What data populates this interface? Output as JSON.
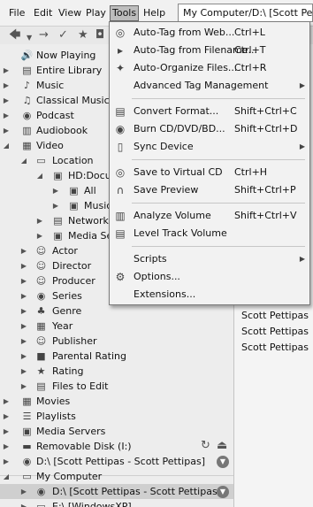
{
  "menubar": {
    "file": "File",
    "edit": "Edit",
    "view": "View",
    "play": "Play",
    "tools": "Tools",
    "help": "Help",
    "path": "My Computer/D:\\ [Scott Pettipas - Scott Pettipas]"
  },
  "tree": {
    "now_playing": "Now Playing",
    "entire_library": "Entire Library",
    "music": "Music",
    "classical_music": "Classical Music",
    "podcast": "Podcast",
    "audiobook": "Audiobook",
    "video": "Video",
    "location": "Location",
    "hd_documents": "HD:Documents",
    "all": "All",
    "music_sub": "Music",
    "network": "Network",
    "media_servers_sub": "Media Servers",
    "actor": "Actor",
    "director": "Director",
    "producer": "Producer",
    "series": "Series",
    "genre": "Genre",
    "year": "Year",
    "publisher": "Publisher",
    "parental_rating": "Parental Rating",
    "rating": "Rating",
    "files_to_edit": "Files to Edit",
    "movies": "Movies",
    "playlists": "Playlists",
    "media_servers": "Media Servers",
    "removable_disk": "Removable Disk (I:)",
    "d_drive": "D:\\ [Scott Pettipas - Scott Pettipas]",
    "my_computer": "My Computer",
    "d_drive_sel": "D:\\ [Scott Pettipas - Scott Pettipas]",
    "e_drive": "E:\\ [WindowsXP]"
  },
  "right_panel": {
    "rows": [
      "Scott Pettipas",
      "Scott Pettipas",
      "Scott Pettipas"
    ]
  },
  "tools_menu": {
    "auto_tag_web": {
      "label": "Auto-Tag from Web...",
      "shortcut": "Ctrl+L"
    },
    "auto_tag_filename": {
      "label": "Auto-Tag from Filename...",
      "shortcut": "Ctrl+T"
    },
    "auto_organize": {
      "label": "Auto-Organize Files...",
      "shortcut": "Ctrl+R"
    },
    "advanced_tag": {
      "label": "Advanced Tag Management"
    },
    "convert_format": {
      "label": "Convert Format...",
      "shortcut": "Shift+Ctrl+C"
    },
    "burn": {
      "label": "Burn CD/DVD/BD...",
      "shortcut": "Shift+Ctrl+D"
    },
    "sync_device": {
      "label": "Sync Device"
    },
    "save_virtual_cd": {
      "label": "Save to Virtual CD",
      "shortcut": "Ctrl+H"
    },
    "save_preview": {
      "label": "Save Preview",
      "shortcut": "Shift+Ctrl+P"
    },
    "analyze_volume": {
      "label": "Analyze Volume",
      "shortcut": "Shift+Ctrl+V"
    },
    "level_track": {
      "label": "Level Track Volume"
    },
    "scripts": {
      "label": "Scripts"
    },
    "options": {
      "label": "Options..."
    },
    "extensions": {
      "label": "Extensions..."
    }
  }
}
